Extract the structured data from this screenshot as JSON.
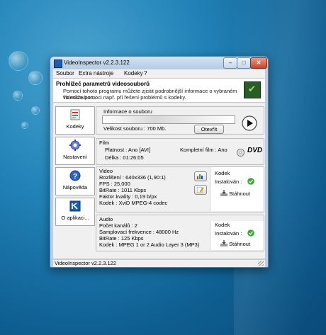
{
  "window": {
    "title": "VideoInspector v2.2.3.122",
    "minimize": "–",
    "maximize": "□",
    "close": "✕"
  },
  "menu": [
    "Soubor",
    "Extra nástroje",
    "Kodeky",
    "?"
  ],
  "header": {
    "title": "Prohlížeč parametrů videosouborů",
    "line1": "Pomocí tohoto programu můžete zjistit podrobnější informace o vybraném videosouboru.",
    "line2": "To může pomoci např. při řešení problémů s kodeky."
  },
  "nav": [
    {
      "label": "Kodeky",
      "icon": "codecs-icon"
    },
    {
      "label": "Nastavení",
      "icon": "settings-gear-icon"
    },
    {
      "label": "Nápověda",
      "icon": "help-icon"
    },
    {
      "label": "O aplikaci...",
      "icon": "about-icon"
    }
  ],
  "file_info": {
    "label": "Informace o souboru",
    "size": "Velikost souboru : 700 Mb.",
    "open_button": "Otevřít"
  },
  "film": {
    "label": "Film",
    "original": "Platnost : Ano [AVI]",
    "complete": "Kompletní film : Ano",
    "duration": "Délka : 01:26:05"
  },
  "video": {
    "label": "Video",
    "resolution": "Rozlišení : 640x336 (1,90:1)",
    "fps": "FPS : 25,000",
    "bitrate": "BitRate : 1011 Kbps",
    "quality": "Faktor kvality : 0,19 b/px",
    "codec": "Kodek : XviD MPEG-4 codec",
    "kodek_title": "Kodek",
    "installed": "Instalován :",
    "download": "Stáhnout"
  },
  "audio": {
    "label": "Audio",
    "channels": "Počet kanálů : 2",
    "samplerate": "Samplovací frekvence : 48000 Hz",
    "bitrate": "BitRate : 125 Kbps",
    "codec": "Kodek : MPEG 1 or 2 Audio Layer 3 (MP3)",
    "kodek_title": "Kodek",
    "installed": "Instalován :",
    "download": "Stáhnout"
  },
  "dvd_logo": "DVD",
  "status": "VideoInspector v2.2.3.122",
  "colors": {
    "desktop": "#1f7bb0",
    "window_frame": "#b9cfe6",
    "installed_ok": "#3aa833"
  }
}
